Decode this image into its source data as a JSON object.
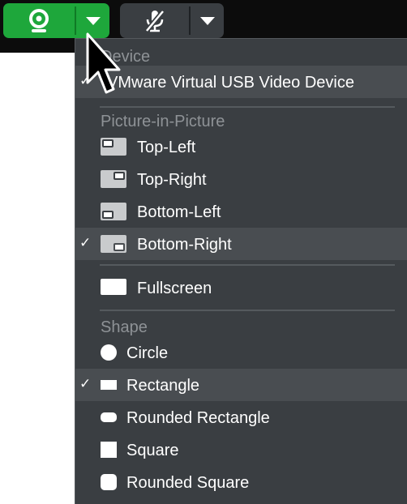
{
  "toolbar": {
    "camera": {
      "icon": "webcam-icon",
      "color": "#1ea73b"
    },
    "microphone": {
      "icon": "microphone-muted-icon",
      "color": "#3a3e42"
    }
  },
  "menu": {
    "device_header": "Device",
    "device_item": "VMware Virtual USB Video Device",
    "pip_header": "Picture-in-Picture",
    "pip_items": [
      {
        "label": "Top-Left",
        "icon": "pip-top-left-icon",
        "checked": false
      },
      {
        "label": "Top-Right",
        "icon": "pip-top-right-icon",
        "checked": false
      },
      {
        "label": "Bottom-Left",
        "icon": "pip-bottom-left-icon",
        "checked": false
      },
      {
        "label": "Bottom-Right",
        "icon": "pip-bottom-right-icon",
        "checked": true
      }
    ],
    "fullscreen": "Fullscreen",
    "shape_header": "Shape",
    "shape_items": [
      {
        "label": "Circle",
        "icon": "circle-icon",
        "checked": false
      },
      {
        "label": "Rectangle",
        "icon": "rectangle-icon",
        "checked": true
      },
      {
        "label": "Rounded Rectangle",
        "icon": "rounded-rectangle-icon",
        "checked": false
      },
      {
        "label": "Square",
        "icon": "square-icon",
        "checked": false
      },
      {
        "label": "Rounded Square",
        "icon": "rounded-square-icon",
        "checked": false
      }
    ],
    "check_glyph": "✓"
  },
  "colors": {
    "menu_bg": "#3a3e42",
    "menu_selected": "#494d51",
    "header_text": "#8e9296",
    "item_text": "#ffffff"
  }
}
